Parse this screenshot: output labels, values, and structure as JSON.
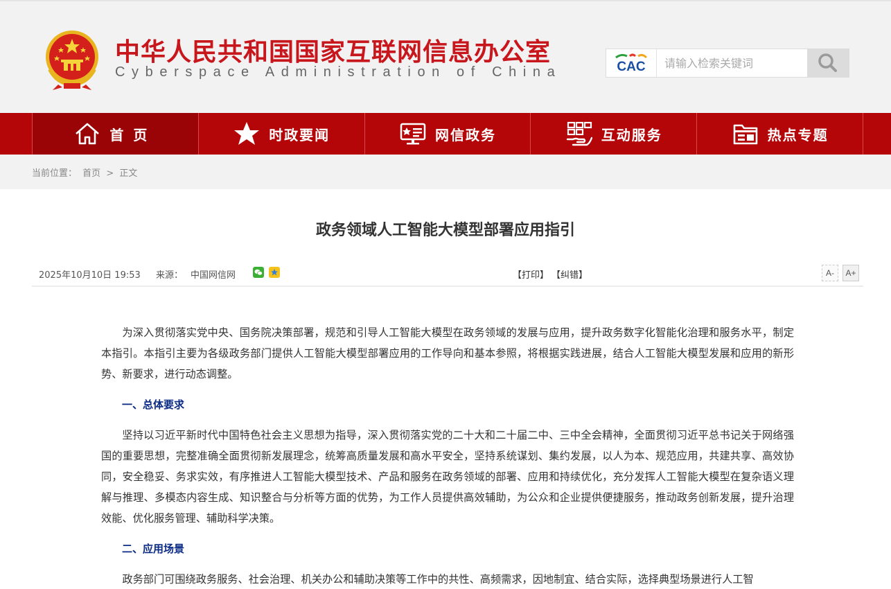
{
  "header": {
    "title_cn": "中华人民共和国国家互联网信息办公室",
    "title_en": "Cyberspace Administration of China",
    "search_placeholder": "请输入检索关键词",
    "logo_text": "CAC"
  },
  "nav": {
    "items": [
      {
        "label": "首页",
        "icon": "home-icon"
      },
      {
        "label": "时政要闻",
        "icon": "star-icon"
      },
      {
        "label": "网信政务",
        "icon": "presentation-icon"
      },
      {
        "label": "互动服务",
        "icon": "service-hand-icon"
      },
      {
        "label": "热点专题",
        "icon": "folder-icon"
      }
    ]
  },
  "breadcrumb": {
    "label": "当前位置：",
    "home": "首页",
    "separator": ">",
    "current": "正文"
  },
  "article": {
    "title": "政务领域人工智能大模型部署应用指引",
    "date": "2025年10月10日 19:53",
    "source_label": "来源：",
    "source": "中国网信网",
    "print": "【打印】",
    "correct": "【纠错】",
    "font_smaller": "A-",
    "font_larger": "A+",
    "paragraphs": {
      "intro": "为深入贯彻落实党中央、国务院决策部署，规范和引导人工智能大模型在政务领域的发展与应用，提升政务数字化智能化治理和服务水平，制定本指引。本指引主要为各级政务部门提供人工智能大模型部署应用的工作导向和基本参照，将根据实践进展，结合人工智能大模型发展和应用的新形势、新要求，进行动态调整。",
      "heading1": "一、总体要求",
      "section1": "坚持以习近平新时代中国特色社会主义思想为指导，深入贯彻落实党的二十大和二十届二中、三中全会精神，全面贯彻习近平总书记关于网络强国的重要思想，完整准确全面贯彻新发展理念，统筹高质量发展和高水平安全，坚持系统谋划、集约发展，以人为本、规范应用，共建共享、高效协同，安全稳妥、务求实效，有序推进人工智能大模型技术、产品和服务在政务领域的部署、应用和持续优化，充分发挥人工智能大模型在复杂语义理解与推理、多模态内容生成、知识整合与分析等方面的优势，为工作人员提供高效辅助，为公众和企业提供便捷服务，推动政务创新发展，提升治理效能、优化服务管理、辅助科学决策。",
      "heading2": "二、应用场景",
      "section2": "政务部门可围绕政务服务、社会治理、机关办公和辅助决策等工作中的共性、高频需求，因地制宜、结合实际，选择典型场景进行人工智"
    }
  },
  "colors": {
    "brand_red": "#c8161d",
    "nav_red": "#b40608",
    "heading_blue": "#0a2a84"
  }
}
